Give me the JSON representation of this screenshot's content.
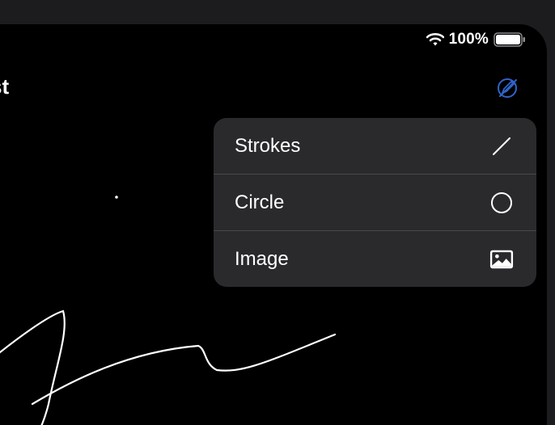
{
  "status_bar": {
    "battery_text": "100%",
    "wifi_icon": "wifi-icon",
    "battery_icon": "battery-full-icon"
  },
  "header": {
    "title_fragment": "st",
    "edit_icon": "pencil-tip-crossed-icon"
  },
  "menu": {
    "items": [
      {
        "label": "Strokes",
        "icon": "diagonal-line-icon"
      },
      {
        "label": "Circle",
        "icon": "circle-icon"
      },
      {
        "label": "Image",
        "icon": "photo-icon"
      }
    ]
  },
  "colors": {
    "canvas_bg": "#000000",
    "frame_bg": "#1c1c1e",
    "menu_bg": "#2a2a2d",
    "accent": "#2f64c9",
    "stroke": "#ffffff"
  }
}
